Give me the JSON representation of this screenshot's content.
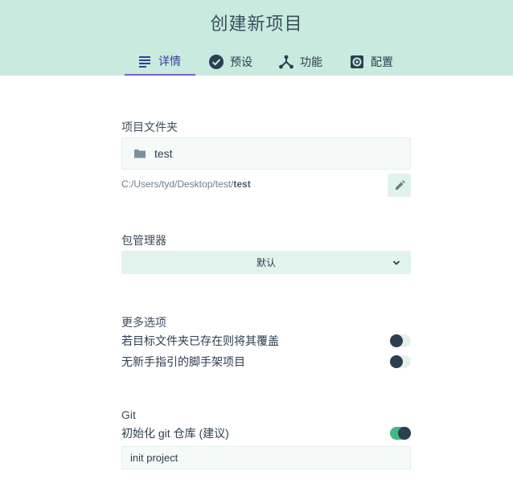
{
  "header": {
    "title": "创建新项目",
    "tabs": [
      {
        "label": "详情",
        "icon": "list-icon",
        "active": true
      },
      {
        "label": "预设",
        "icon": "check-circle-icon",
        "active": false
      },
      {
        "label": "功能",
        "icon": "fork-icon",
        "active": false
      },
      {
        "label": "配置",
        "icon": "gear-icon",
        "active": false
      }
    ]
  },
  "folder": {
    "label": "项目文件夹",
    "value": "test",
    "icon": "folder-icon",
    "path_prefix": "C:/Users/tyd/Desktop/test/",
    "path_name": "test",
    "edit_icon": "pencil-icon"
  },
  "package_manager": {
    "label": "包管理器",
    "selected": "默认"
  },
  "more_options": {
    "label": "更多选项",
    "options": [
      {
        "label": "若目标文件夹已存在则将其覆盖",
        "enabled": false
      },
      {
        "label": "无新手指引的脚手架项目",
        "enabled": false
      }
    ]
  },
  "git": {
    "label": "Git",
    "init_label": "初始化 git 仓库 (建议)",
    "init_enabled": true,
    "commit_message": "init project"
  },
  "colors": {
    "header_bg": "#c8eadf",
    "accent": "#42b983",
    "active_tab": "#7a5ed0",
    "text": "#2c3e50"
  }
}
